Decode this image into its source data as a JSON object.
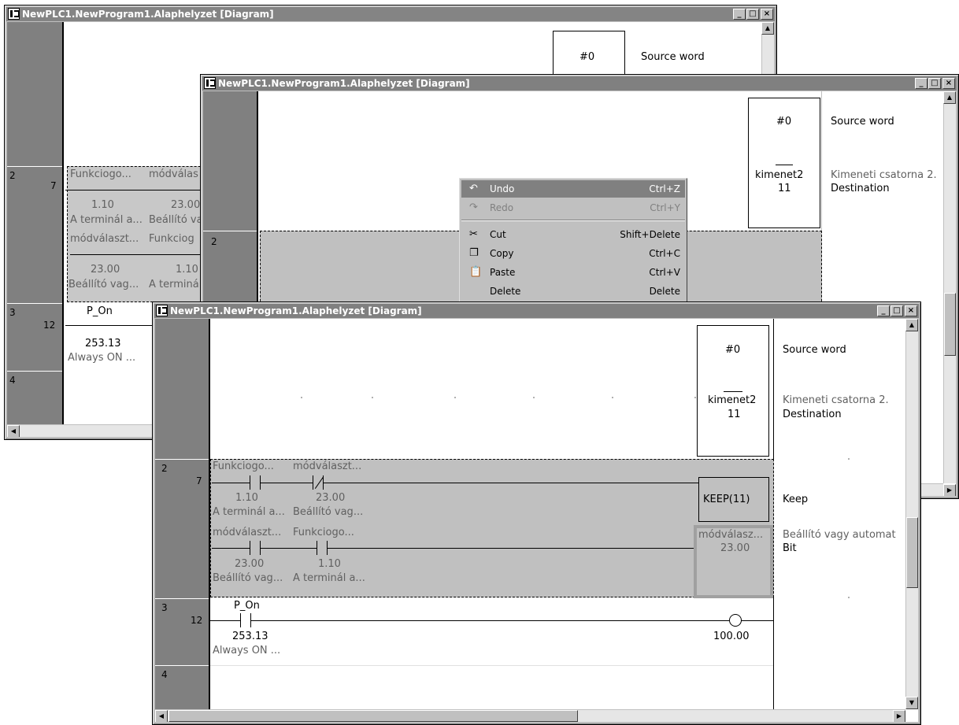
{
  "windows": [
    {
      "title": "NewPLC1.NewProgram1.Alaphelyzet [Diagram]"
    },
    {
      "title": "NewPLC1.NewProgram1.Alaphelyzet [Diagram]"
    },
    {
      "title": "NewPLC1.NewProgram1.Alaphelyzet [Diagram]"
    }
  ],
  "title_buttons": {
    "minimize": "_",
    "maximize": "□",
    "close": "×"
  },
  "rung_numbers": {
    "r2": "2",
    "r2_step": "7",
    "r3": "3",
    "r3_step": "12",
    "r4": "4"
  },
  "instruction": {
    "source_value": "#0",
    "source_desc": "Source word",
    "dest_symbol": "kimenet2",
    "dest_addr": "11",
    "dest_desc1": "Kimeneti csatorna 2.",
    "dest_desc2": "Destination",
    "keep_label": "KEEP(11)",
    "keep_desc": "Keep",
    "bit_symbol": "módválasz...",
    "bit_addr": "23.00",
    "bit_desc1": "Beállító vagy automat",
    "bit_desc2": "Bit"
  },
  "contacts": {
    "c1_name": "Funkciogo...",
    "c1_addr": "1.10",
    "c1_comment": "A terminál a...",
    "c2_name": "módválaszt...",
    "c2_addr": "23.00",
    "c2_comment": "Beállító vag...",
    "c3_name": "módválaszt...",
    "c3_addr": "23.00",
    "c3_comment": "Beállító vag...",
    "c4_name": "Funkciogo...",
    "c4_addr": "1.10",
    "c4_comment": "A terminál a...",
    "p_on_name": "P_On",
    "p_on_addr": "253.13",
    "p_on_comment": "Always ON ...",
    "coil_addr": "100.00"
  },
  "win1_partial": {
    "c1_name": "Funkciogo...",
    "c2_name": "módválas",
    "c1_addr": "1.10",
    "c2_addr": "23.00",
    "c1_comment": "A terminál a...",
    "c2_comment": "Beállító va",
    "c3_name": "módválaszt...",
    "c4_name": "Funkciog",
    "c3_addr": "23.00",
    "c4_addr": "1.10",
    "c3_comment": "Beállító vag...",
    "c4_comment": "A terminál"
  },
  "context_menu": {
    "items": [
      {
        "label": "Undo",
        "shortcut": "Ctrl+Z",
        "icon": "undo-icon",
        "state": "highlighted"
      },
      {
        "label": "Redo",
        "shortcut": "Ctrl+Y",
        "icon": "redo-icon",
        "state": "disabled"
      },
      {
        "label": "Cut",
        "shortcut": "Shift+Delete",
        "icon": "scissors-icon",
        "state": "normal"
      },
      {
        "label": "Copy",
        "shortcut": "Ctrl+C",
        "icon": "copy-icon",
        "state": "normal"
      },
      {
        "label": "Paste",
        "shortcut": "Ctrl+V",
        "icon": "paste-icon",
        "state": "normal"
      },
      {
        "label": "Delete",
        "shortcut": "Delete",
        "icon": "",
        "state": "normal"
      }
    ]
  },
  "colors": {
    "title_inactive": "#808080",
    "selection": "#c0c0c0",
    "gutter": "#808080"
  }
}
